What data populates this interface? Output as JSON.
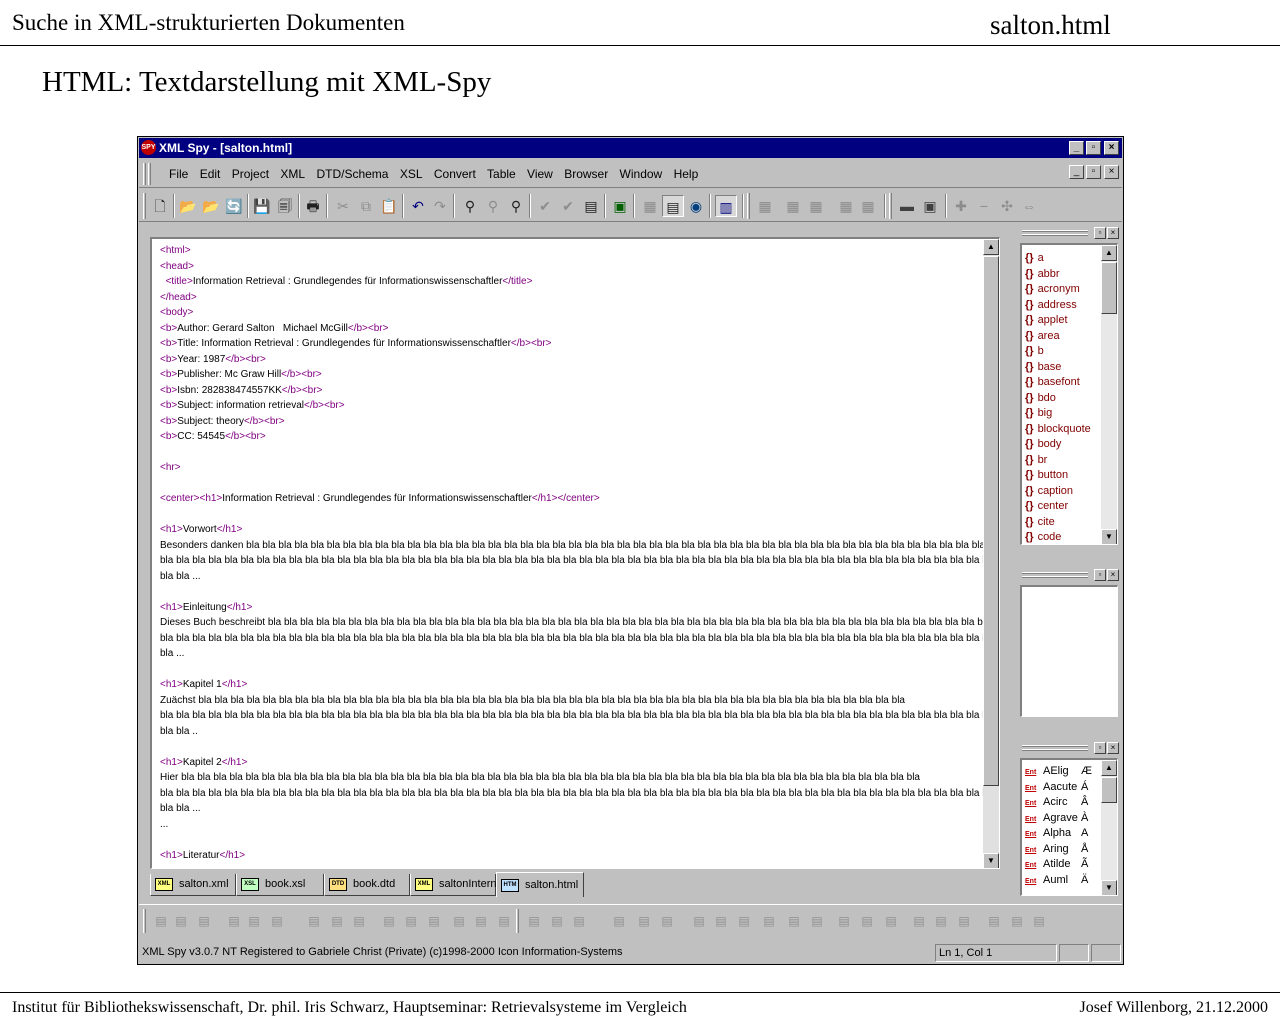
{
  "slide": {
    "header_left": "Suche in XML-strukturierten Dokumenten",
    "header_right": "salton.html",
    "title": "HTML: Textdarstellung mit XML-Spy",
    "footer_left": "Institut für Bibliothekswissenschaft, Dr. phil. Iris Schwarz, Hauptseminar: Retrievalsysteme im Vergleich",
    "footer_right": "Josef Willenborg, 21.12.2000"
  },
  "window": {
    "title": "XML Spy - [salton.html]",
    "app_badge": "SPY",
    "title_color": "#000080"
  },
  "menu": [
    "File",
    "Edit",
    "Project",
    "XML",
    "DTD/Schema",
    "XSL",
    "Convert",
    "Table",
    "View",
    "Browser",
    "Window",
    "Help"
  ],
  "icons": {
    "new": "new-document-icon",
    "open": "open-folder-icon",
    "save": "save-disk-icon",
    "print": "printer-icon",
    "cut": "scissors-icon",
    "copy": "copy-icon",
    "paste": "paste-icon",
    "undo": "undo-icon",
    "redo": "redo-icon",
    "find": "binoculars-icon"
  },
  "editor": {
    "lines": [
      [
        {
          "t": "tag",
          "v": "<html>"
        }
      ],
      [
        {
          "t": "tag",
          "v": "<head>"
        }
      ],
      [
        {
          "t": "txt",
          "v": "  "
        },
        {
          "t": "tag",
          "v": "<title>"
        },
        {
          "t": "txt",
          "v": "Information Retrieval : Grundlegendes für Informationswissenschaftler"
        },
        {
          "t": "tag",
          "v": "</title>"
        }
      ],
      [
        {
          "t": "tag",
          "v": "</head>"
        }
      ],
      [
        {
          "t": "tag",
          "v": "<body>"
        }
      ],
      [
        {
          "t": "tag",
          "v": "<b>"
        },
        {
          "t": "txt",
          "v": "Author: Gerard Salton   Michael McGill"
        },
        {
          "t": "tag",
          "v": "</b><br>"
        }
      ],
      [
        {
          "t": "tag",
          "v": "<b>"
        },
        {
          "t": "txt",
          "v": "Title: Information Retrieval : Grundlegendes für Informationswissenschaftler"
        },
        {
          "t": "tag",
          "v": "</b><br>"
        }
      ],
      [
        {
          "t": "tag",
          "v": "<b>"
        },
        {
          "t": "txt",
          "v": "Year: 1987"
        },
        {
          "t": "tag",
          "v": "</b><br>"
        }
      ],
      [
        {
          "t": "tag",
          "v": "<b>"
        },
        {
          "t": "txt",
          "v": "Publisher: Mc Graw Hill"
        },
        {
          "t": "tag",
          "v": "</b><br>"
        }
      ],
      [
        {
          "t": "tag",
          "v": "<b>"
        },
        {
          "t": "txt",
          "v": "Isbn: 282838474557KK"
        },
        {
          "t": "tag",
          "v": "</b><br>"
        }
      ],
      [
        {
          "t": "tag",
          "v": "<b>"
        },
        {
          "t": "txt",
          "v": "Subject: information retrieval"
        },
        {
          "t": "tag",
          "v": "</b><br>"
        }
      ],
      [
        {
          "t": "tag",
          "v": "<b>"
        },
        {
          "t": "txt",
          "v": "Subject: theory"
        },
        {
          "t": "tag",
          "v": "</b><br>"
        }
      ],
      [
        {
          "t": "tag",
          "v": "<b>"
        },
        {
          "t": "txt",
          "v": "CC: 54545"
        },
        {
          "t": "tag",
          "v": "</b><br>"
        }
      ],
      [],
      [
        {
          "t": "tag",
          "v": "<hr>"
        }
      ],
      [],
      [
        {
          "t": "tag",
          "v": "<center><h1>"
        },
        {
          "t": "txt",
          "v": "Information Retrieval : Grundlegendes für Informationswissenschaftler"
        },
        {
          "t": "tag",
          "v": "</h1></center>"
        }
      ],
      [],
      [
        {
          "t": "tag",
          "v": "<h1>"
        },
        {
          "t": "txt",
          "v": "Vorwort"
        },
        {
          "t": "tag",
          "v": "</h1>"
        }
      ],
      [
        {
          "t": "txt",
          "v": "Besonders danken bla bla bla bla bla bla bla bla bla bla bla bla bla bla bla bla bla bla bla bla bla bla bla bla bla bla bla bla bla bla bla bla bla bla bla bla bla bla bla bla bla bla bla bla bla bla bla bla bla"
        }
      ],
      [
        {
          "t": "txt",
          "v": "bla bla bla bla bla bla bla bla bla bla bla bla bla bla bla bla bla bla bla bla bla bla bla bla bla bla bla bla bla bla bla bla bla bla bla bla bla bla bla bla bla bla bla bla bla bla bla bla bla bla bla bla bla bla bla bla bla bla"
        }
      ],
      [
        {
          "t": "txt",
          "v": "bla bla ..."
        }
      ],
      [],
      [
        {
          "t": "tag",
          "v": "<h1>"
        },
        {
          "t": "txt",
          "v": "Einleitung"
        },
        {
          "t": "tag",
          "v": "</h1>"
        }
      ],
      [
        {
          "t": "txt",
          "v": "Dieses Buch beschreibt bla bla bla bla bla bla bla bla bla bla bla bla bla bla bla bla bla bla bla bla bla bla bla bla bla bla bla bla bla bla bla bla bla bla bla bla bla bla bla bla bla bla bla bla bla bla bla bla bla bla bla bla bla"
        }
      ],
      [
        {
          "t": "txt",
          "v": "bla bla bla bla bla bla bla bla bla bla bla bla bla bla bla bla bla bla bla bla bla bla bla bla bla bla bla bla bla bla bla bla bla bla bla bla bla bla bla bla bla bla bla bla bla bla bla bla bla bla bla bla bla bla bla bla bla bla"
        }
      ],
      [
        {
          "t": "txt",
          "v": "bla ..."
        }
      ],
      [],
      [
        {
          "t": "tag",
          "v": "<h1>"
        },
        {
          "t": "txt",
          "v": "Kapitel 1"
        },
        {
          "t": "tag",
          "v": "</h1>"
        }
      ],
      [
        {
          "t": "txt",
          "v": "Zuächst bla bla bla bla bla bla bla bla bla bla bla bla bla bla bla bla bla bla bla bla bla bla bla bla bla bla bla bla bla bla bla bla bla bla bla bla bla bla bla bla bla bla bla bla"
        }
      ],
      [
        {
          "t": "txt",
          "v": "bla bla bla bla bla bla bla bla bla bla bla bla bla bla bla bla bla bla bla bla bla bla bla bla bla bla bla bla bla bla bla bla bla bla bla bla bla bla bla bla bla bla bla bla bla bla bla bla bla bla bla bla bla bla bla bla bla bla"
        }
      ],
      [
        {
          "t": "txt",
          "v": "bla bla .."
        }
      ],
      [],
      [
        {
          "t": "tag",
          "v": "<h1>"
        },
        {
          "t": "txt",
          "v": "Kapitel 2"
        },
        {
          "t": "tag",
          "v": "</h1>"
        }
      ],
      [
        {
          "t": "txt",
          "v": "Hier bla bla bla bla bla bla bla bla bla bla bla bla bla bla bla bla bla bla bla bla bla bla bla bla bla bla bla bla bla bla bla bla bla bla bla bla bla bla bla bla bla bla bla bla bla bla"
        }
      ],
      [
        {
          "t": "txt",
          "v": "bla bla bla bla bla bla bla bla bla bla bla bla bla bla bla bla bla bla bla bla bla bla bla bla bla bla bla bla bla bla bla bla bla bla bla bla bla bla bla bla bla bla bla bla bla bla bla bla bla bla bla bla bla bla bla bla bla bla"
        }
      ],
      [
        {
          "t": "txt",
          "v": "bla bla ..."
        }
      ],
      [
        {
          "t": "txt",
          "v": "..."
        }
      ],
      [],
      [
        {
          "t": "tag",
          "v": "<h1>"
        },
        {
          "t": "txt",
          "v": "Literatur"
        },
        {
          "t": "tag",
          "v": "</h1>"
        }
      ]
    ]
  },
  "tabs": [
    {
      "label": "salton.xml",
      "icon": "XML",
      "active": false
    },
    {
      "label": "book.xsl",
      "icon": "XSL",
      "active": false
    },
    {
      "label": "book.dtd",
      "icon": "DTD",
      "active": false
    },
    {
      "label": "saltonIntern...",
      "icon": "XML",
      "active": false
    },
    {
      "label": "salton.html",
      "icon": "HTM",
      "active": true
    }
  ],
  "elements_panel": {
    "brace": "{}",
    "items": [
      "a",
      "abbr",
      "acronym",
      "address",
      "applet",
      "area",
      "b",
      "base",
      "basefont",
      "bdo",
      "big",
      "blockquote",
      "body",
      "br",
      "button",
      "caption",
      "center",
      "cite",
      "code"
    ]
  },
  "entities_panel": {
    "badge": "Ent",
    "items": [
      {
        "name": "AElig",
        "char": "Æ"
      },
      {
        "name": "Aacute",
        "char": "Á"
      },
      {
        "name": "Acirc",
        "char": "Â"
      },
      {
        "name": "Agrave",
        "char": "À"
      },
      {
        "name": "Alpha",
        "char": "Α"
      },
      {
        "name": "Aring",
        "char": "Å"
      },
      {
        "name": "Atilde",
        "char": "Ã"
      },
      {
        "name": "Auml",
        "char": "Ä"
      }
    ]
  },
  "status": {
    "info": "XML Spy v3.0.7 NT    Registered to Gabriele Christ (Private)   (c)1998-2000 Icon Information-Systems",
    "position": "Ln 1, Col 1"
  },
  "captions": {
    "min": "_",
    "max": "▫",
    "close": "×",
    "up": "▲",
    "down": "▼"
  }
}
